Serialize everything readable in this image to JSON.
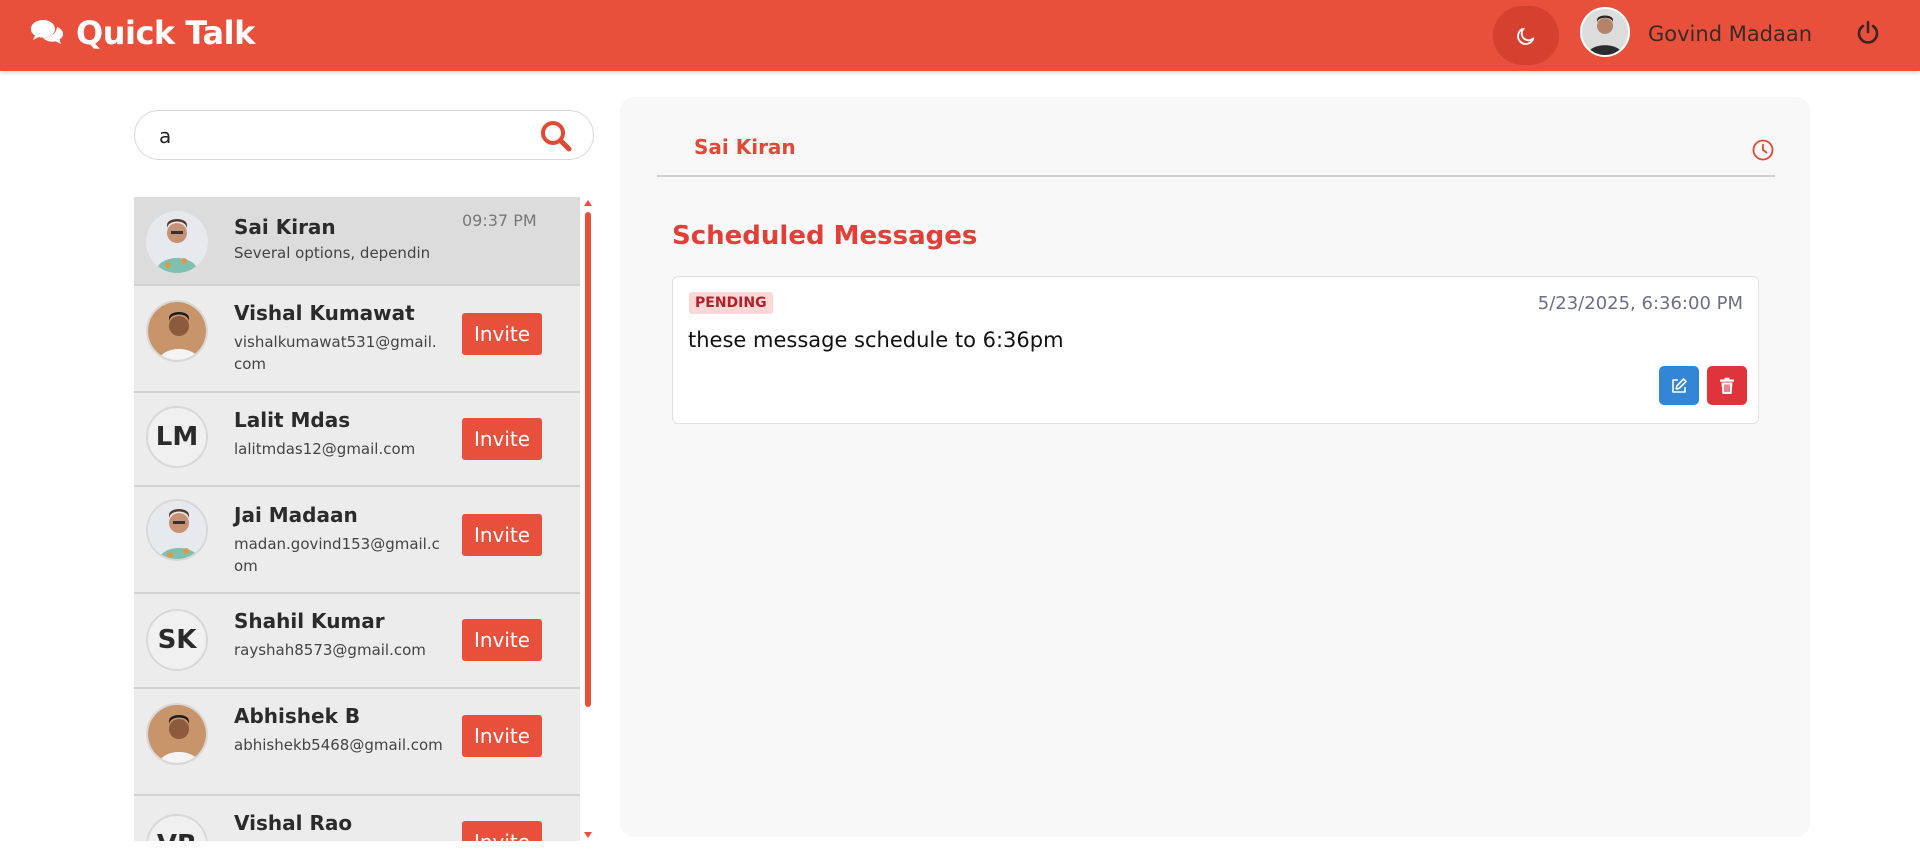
{
  "header": {
    "app_name": "Quick Talk",
    "user_name": "Govind Madaan",
    "theme_icon": "moon-icon",
    "logout_icon": "power-icon",
    "brand_color": "#e8503c"
  },
  "search": {
    "value": "a",
    "placeholder": "Search"
  },
  "contacts": [
    {
      "name": "Sai Kiran",
      "subtitle": "Several options, dependin",
      "time": "09:37 PM",
      "avatar": "photo",
      "active": true
    },
    {
      "name": "Vishal Kumawat",
      "subtitle": "vishalkumawat531@gmail.com",
      "action": "Invite",
      "avatar": "photo"
    },
    {
      "name": "Lalit Mdas",
      "subtitle": "lalitmdas12@gmail.com",
      "action": "Invite",
      "initials": "LM"
    },
    {
      "name": "Jai Madaan",
      "subtitle": "madan.govind153@gmail.com",
      "action": "Invite",
      "avatar": "photo"
    },
    {
      "name": "Shahil Kumar",
      "subtitle": "rayshah8573@gmail.com",
      "action": "Invite",
      "initials": "SK"
    },
    {
      "name": "Abhishek B",
      "subtitle": "abhishekb5468@gmail.com",
      "action": "Invite",
      "avatar": "photo"
    },
    {
      "name": "Vishal Rao",
      "subtitle": "",
      "action": "Invite",
      "initials": "VR"
    }
  ],
  "chat": {
    "title": "Sai Kiran",
    "section_title": "Scheduled Messages",
    "messages": [
      {
        "status": "PENDING",
        "datetime": "5/23/2025, 6:36:00 PM",
        "text": "these message schedule to 6:36pm"
      }
    ]
  }
}
